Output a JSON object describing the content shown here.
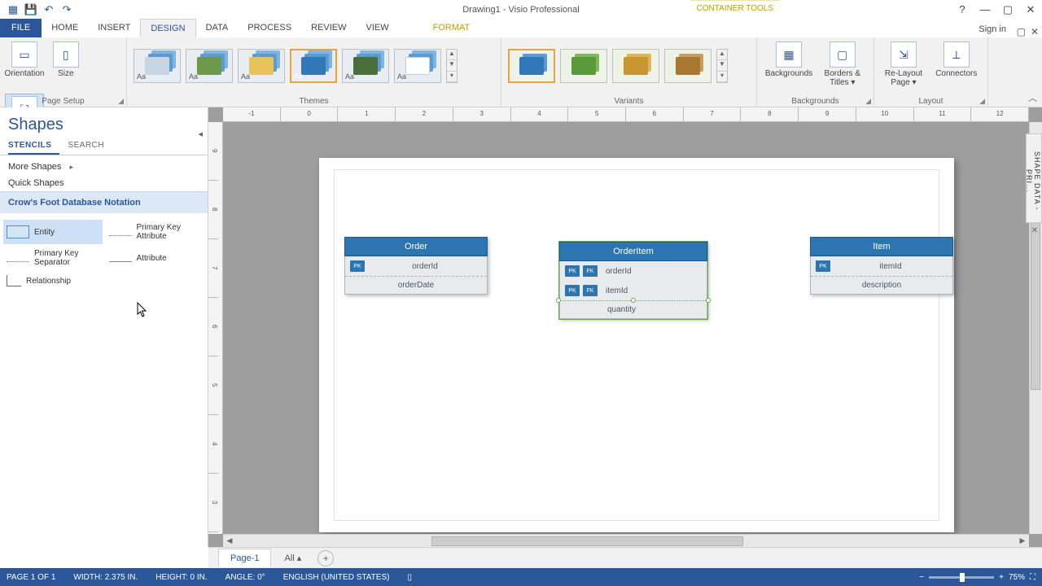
{
  "titlebar": {
    "doc": "Drawing1 - Visio Professional",
    "container_tools": "CONTAINER TOOLS"
  },
  "tabs": {
    "file": "FILE",
    "home": "HOME",
    "insert": "INSERT",
    "design": "DESIGN",
    "data": "DATA",
    "process": "PROCESS",
    "review": "REVIEW",
    "view": "VIEW",
    "format": "FORMAT",
    "signin": "Sign in"
  },
  "ribbon": {
    "page_setup": {
      "label": "Page Setup",
      "orientation": "Orientation",
      "size": "Size",
      "autosize": "Auto Size"
    },
    "themes": {
      "label": "Themes"
    },
    "variants": {
      "label": "Variants"
    },
    "backgrounds": {
      "label": "Backgrounds",
      "bg": "Backgrounds",
      "borders": "Borders & Titles ▾"
    },
    "layout": {
      "label": "Layout",
      "relayout": "Re-Layout Page ▾",
      "connectors": "Connectors"
    }
  },
  "shapes": {
    "title": "Shapes",
    "tab_stencils": "STENCILS",
    "tab_search": "SEARCH",
    "more": "More Shapes",
    "quick": "Quick Shapes",
    "stencil": "Crow's Foot Database Notation",
    "items": {
      "entity": "Entity",
      "pk_attr": "Primary Key Attribute",
      "pk_sep": "Primary Key Separator",
      "attribute": "Attribute",
      "relationship": "Relationship"
    }
  },
  "entities": {
    "order": {
      "title": "Order",
      "rows": [
        {
          "keys": [
            "PK"
          ],
          "name": "orderId"
        },
        {
          "keys": [],
          "name": "orderDate"
        }
      ]
    },
    "orderitem": {
      "title": "OrderItem",
      "rows": [
        {
          "keys": [
            "PK",
            "FK"
          ],
          "name": "orderId"
        },
        {
          "keys": [
            "PK",
            "FK"
          ],
          "name": "itemId"
        },
        {
          "keys": [],
          "name": "quantity"
        }
      ]
    },
    "item": {
      "title": "Item",
      "rows": [
        {
          "keys": [
            "PK"
          ],
          "name": "itemId"
        },
        {
          "keys": [],
          "name": "description"
        }
      ]
    }
  },
  "page_tabs": {
    "page1": "Page-1",
    "all": "All ▴"
  },
  "status": {
    "page": "PAGE 1 OF 1",
    "width": "WIDTH: 2.375 IN.",
    "height": "HEIGHT: 0 IN.",
    "angle": "ANGLE: 0°",
    "lang": "ENGLISH (UNITED STATES)",
    "zoom": "75%"
  },
  "shape_data_tab": "SHAPE DATA - PRI..."
}
